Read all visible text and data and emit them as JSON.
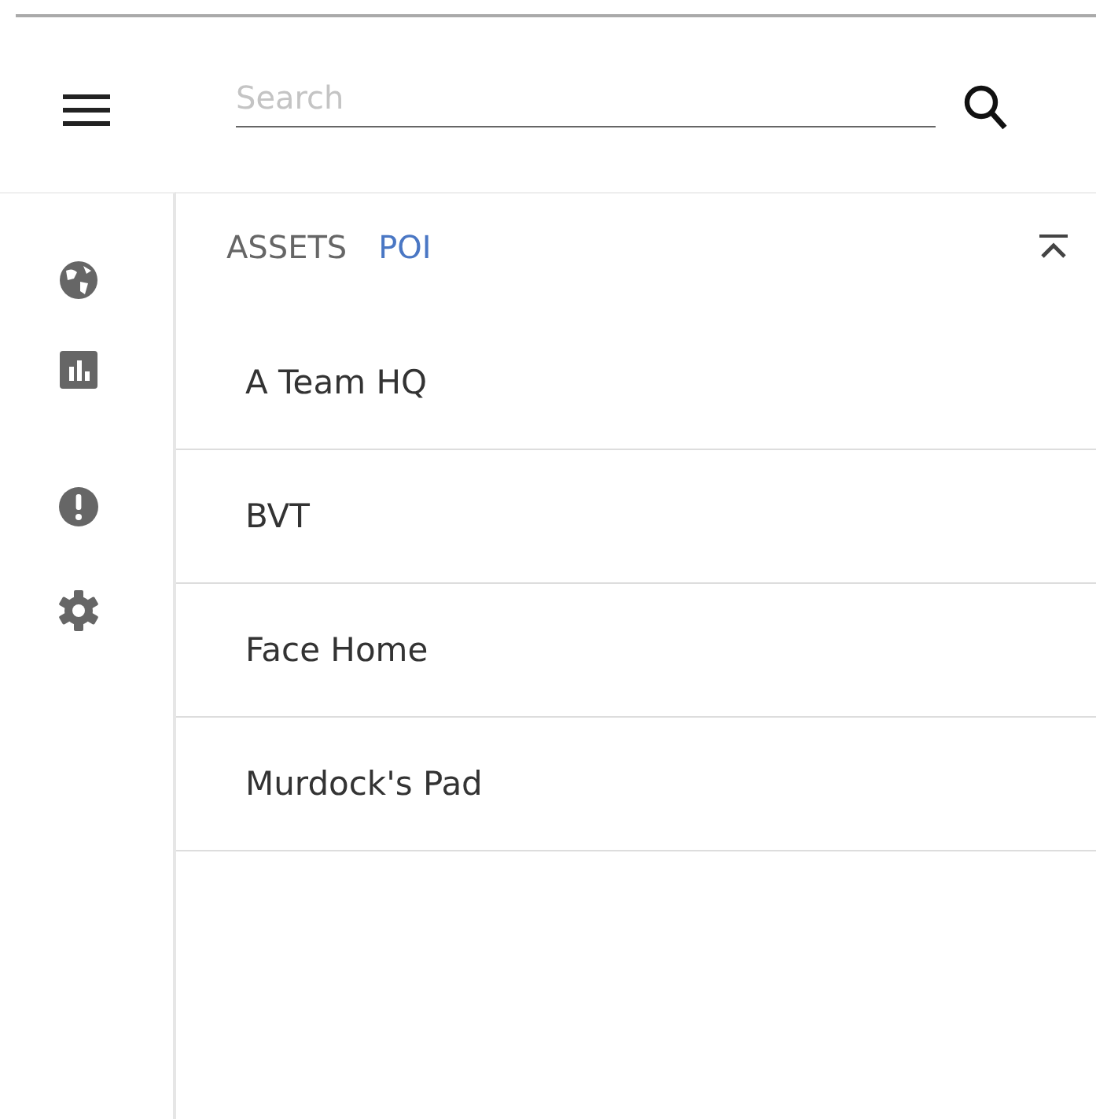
{
  "search": {
    "placeholder": "Search"
  },
  "tabs": [
    {
      "label": "ASSETS",
      "selected": false
    },
    {
      "label": "POI",
      "selected": true
    }
  ],
  "items": [
    {
      "label": "A Team HQ"
    },
    {
      "label": "BVT"
    },
    {
      "label": "Face Home"
    },
    {
      "label": "Murdock's Pad"
    }
  ]
}
